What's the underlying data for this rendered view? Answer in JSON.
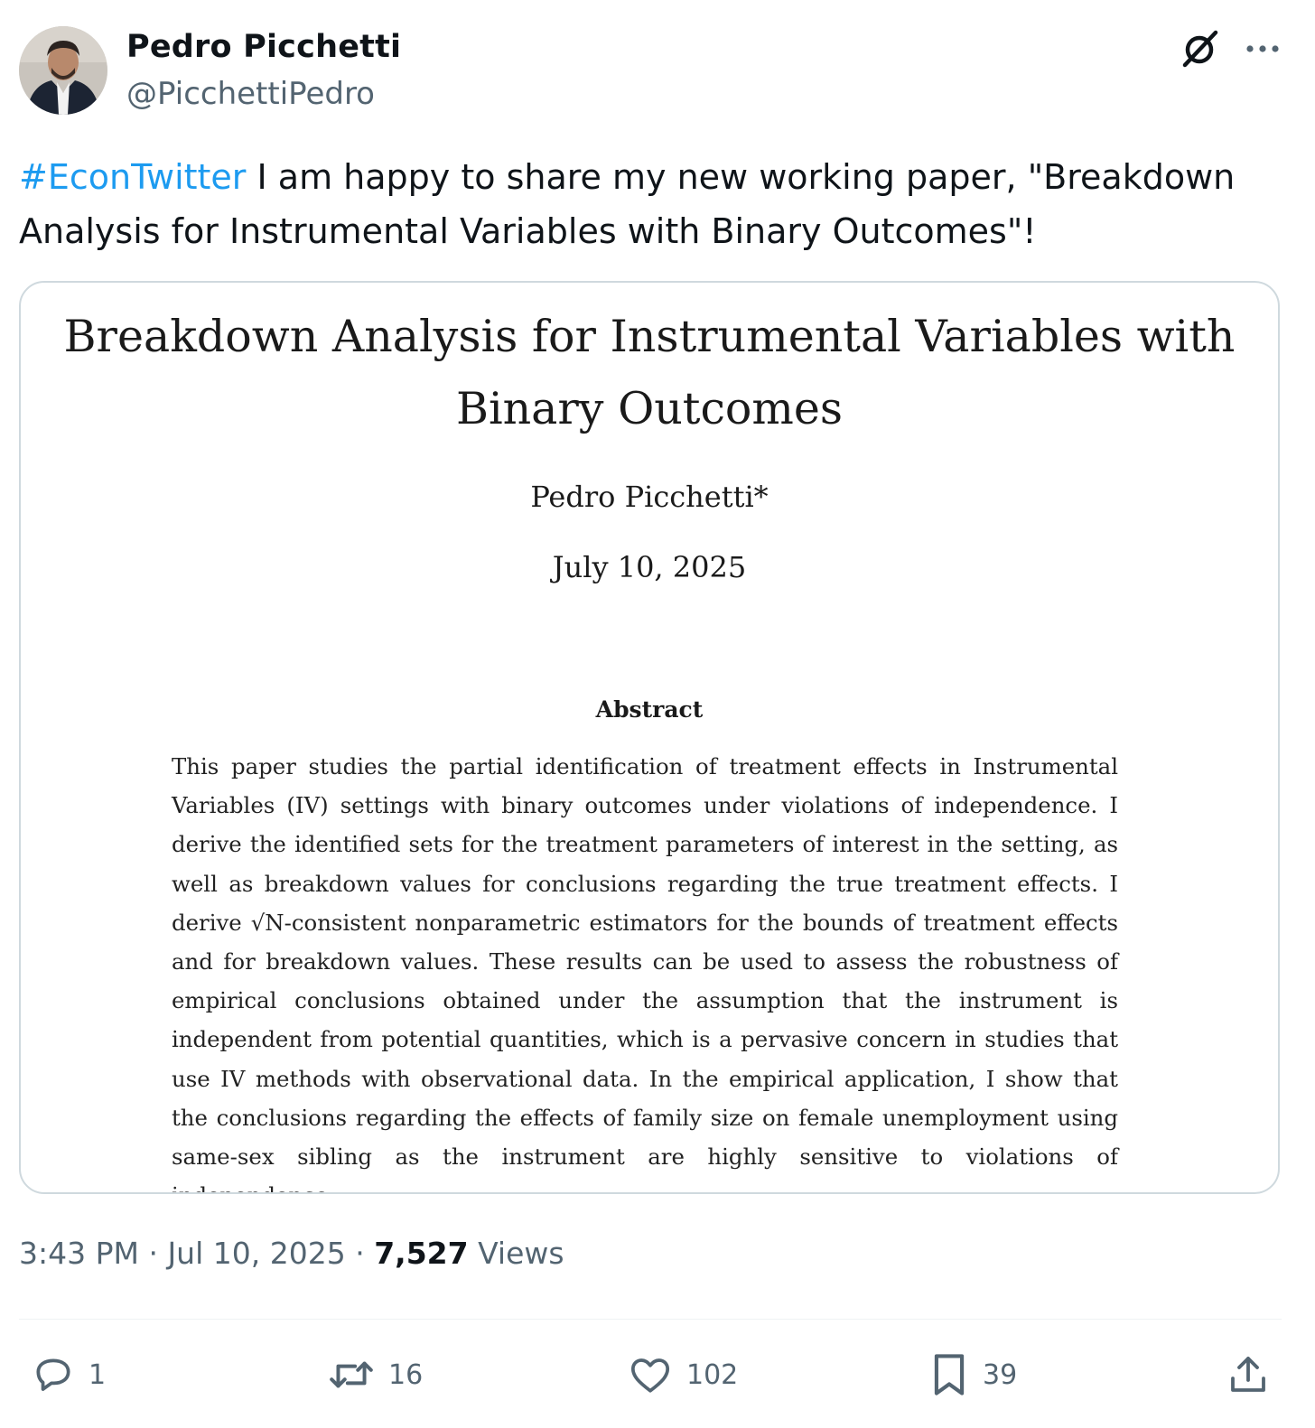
{
  "author": {
    "name": "Pedro Picchetti",
    "handle": "@PicchettiPedro"
  },
  "tweet": {
    "hashtag": "#EconTwitter",
    "text": " I am happy to share my new working paper, \"Breakdown Analysis for Instrumental Variables with Binary Outcomes\"!"
  },
  "paper": {
    "title_line1": "Breakdown Analysis for Instrumental Variables with",
    "title_line2": "Binary Outcomes",
    "author": "Pedro Picchetti*",
    "date": "July 10, 2025",
    "abstract_heading": "Abstract",
    "abstract": "This paper studies the partial identification of treatment effects in Instrumental Variables (IV) settings with binary outcomes under violations of independence. I derive the identified sets for the treatment parameters of interest in the setting, as well as breakdown values for conclusions regarding the true treatment effects. I derive √N-consistent nonparametric estimators for the bounds of treatment effects and for breakdown values. These results can be used to assess the robustness of empirical conclusions obtained under the assumption that the instrument is independent from potential quantities, which is a pervasive concern in studies that use IV methods with observational data. In the empirical application, I show that the conclusions regarding the effects of family size on female unemployment using same-sex sibling as the instrument are highly sensitive to violations of independence."
  },
  "meta": {
    "time": "3:43 PM",
    "separator1": " · ",
    "date": "Jul 10, 2025",
    "separator2": " · ",
    "views_count": "7,527",
    "views_label": " Views"
  },
  "actions": {
    "replies": "1",
    "reposts": "16",
    "likes": "102",
    "bookmarks": "39"
  },
  "icons": {
    "reply": "reply-icon",
    "repost": "repost-icon",
    "like": "heart-icon",
    "bookmark": "bookmark-icon",
    "share": "share-icon",
    "grok": "grok-icon",
    "more": "more-icon"
  },
  "colors": {
    "link": "#1d9bf0",
    "secondary_text": "#536471",
    "primary_text": "#0f1419",
    "border": "#cfd9de"
  }
}
